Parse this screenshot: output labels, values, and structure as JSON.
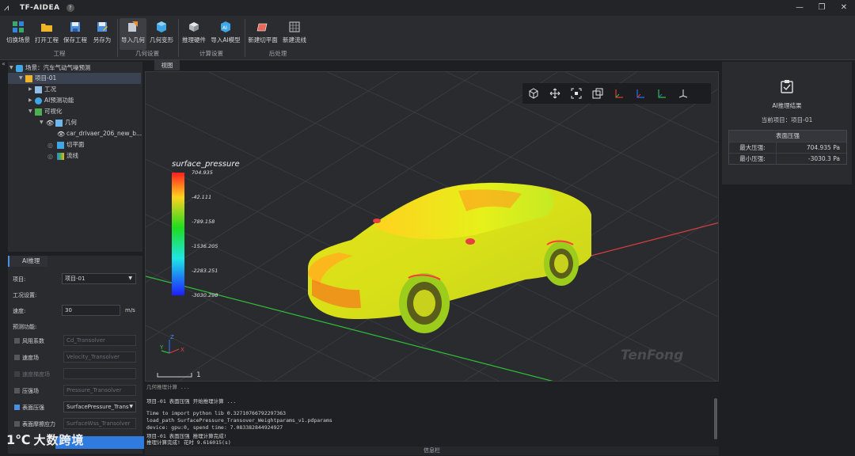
{
  "app": {
    "title": "TF-AIDEA",
    "help": "?"
  },
  "window_controls": {
    "minimize": "—",
    "restore": "❐",
    "close": "✕"
  },
  "ribbon": {
    "groups": [
      {
        "label": "工程",
        "buttons": [
          "切换场景",
          "打开工程",
          "保存工程",
          "另存为"
        ]
      },
      {
        "label": "几何设置",
        "buttons": [
          "导入几何",
          "几何变形"
        ]
      },
      {
        "label": "计算设置",
        "buttons": [
          "推理硬件",
          "导入AI模型"
        ]
      },
      {
        "label": "后处理",
        "buttons": [
          "新建切平面",
          "新建流线"
        ]
      }
    ]
  },
  "tree": {
    "scene": "场景：汽车气动气噪预测",
    "project": "项目-01",
    "condition": "工况",
    "ai_function": "AI预测功能",
    "visualization": "可视化",
    "geometry": "几何",
    "geometry_file": "car_drivaer_206_new_b...",
    "cut_plane": "切平面",
    "streamline": "流线"
  },
  "ai_panel": {
    "tab": "AI推理",
    "project_label": "项目:",
    "project_value": "项目-01",
    "condition_label": "工况设置:",
    "speed_label": "速度:",
    "speed_value": "30",
    "speed_unit": "m/s",
    "predict_label": "预测功能:",
    "functions": [
      {
        "label": "风阻系数",
        "model": "Cd_Transolver",
        "checked": false,
        "enabled": true
      },
      {
        "label": "速度场",
        "model": "Velocity_Transolver",
        "checked": false,
        "enabled": true
      },
      {
        "label": "速度梯度场",
        "model": "",
        "checked": false,
        "enabled": false
      },
      {
        "label": "压强场",
        "model": "Pressure_Transolver",
        "checked": false,
        "enabled": true
      },
      {
        "label": "表面压强",
        "model": "SurfacePressure_Transo",
        "checked": true,
        "enabled": true,
        "dropdown": true
      },
      {
        "label": "表面摩擦应力",
        "model": "SurfaceWss_Transolver",
        "checked": false,
        "enabled": true
      }
    ]
  },
  "viewport": {
    "tab": "视图",
    "legend_title": "surface_pressure",
    "legend_ticks": [
      "704.935",
      "-42.111",
      "-789.158",
      "-1536.205",
      "-2283.251",
      "-3030.298"
    ],
    "scale_value": "1",
    "watermark": "TenFong",
    "axes": {
      "x": "X",
      "y": "Y",
      "z": "Z"
    }
  },
  "result_panel": {
    "title": "AI推理结果",
    "project": "当前项目：项目-01",
    "table_header": "表面压强",
    "rows": [
      {
        "key": "最大压强:",
        "value": "704.935 Pa"
      },
      {
        "key": "最小压强:",
        "value": "-3030.3 Pa"
      }
    ]
  },
  "log": {
    "lines": [
      "几何推理计算 ...",
      "项目-01 表面压强 开始推理计算 ...",
      "Time to import python lib 0.32710766792297363",
      "load_path SurfacePressure_Transover_Weightparams_v1.pdparams",
      "device: gpu:0, spend time: 7.083382844924927",
      "项目-01 表面压强 推理计算完成!",
      "推理计算完成! 花时 9.616015(s)"
    ],
    "statusbar": "信息栏"
  },
  "watermark_brand": {
    "mark": "1℃",
    "text": "大数跨境"
  }
}
